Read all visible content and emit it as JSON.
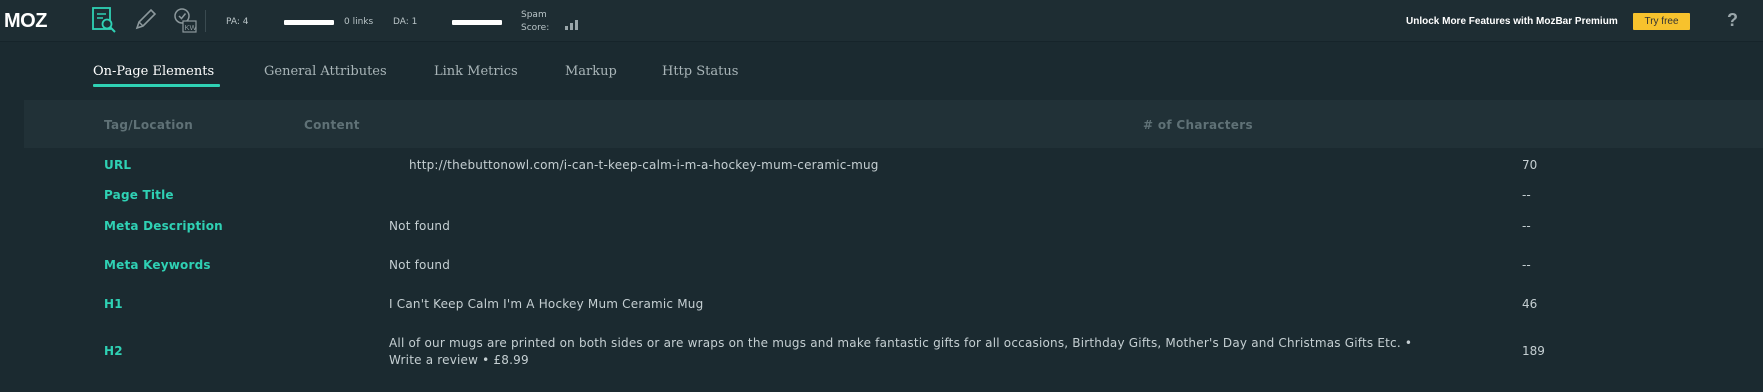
{
  "toolbar": {
    "logo": "MOZ",
    "icons": [
      "page-analysis-icon",
      "highlight-pencil-icon",
      "keyword-icon"
    ],
    "pa_label": "PA: 4",
    "pa_fill": 1.0,
    "links_label": "0 links",
    "da_label": "DA: 1",
    "da_fill": 1.0,
    "spam_label_line1": "Spam",
    "spam_label_line2": "Score:",
    "promo_text": "Unlock More Features with MozBar Premium",
    "try_button": "Try free",
    "help": "?"
  },
  "colors": {
    "accent": "#2fd1b4",
    "background": "#1b2a30",
    "try_button_bg": "#f7c22d"
  },
  "tabs": [
    {
      "label": "On-Page Elements",
      "active": true
    },
    {
      "label": "General Attributes",
      "active": false
    },
    {
      "label": "Link Metrics",
      "active": false
    },
    {
      "label": "Markup",
      "active": false
    },
    {
      "label": "Http Status",
      "active": false
    }
  ],
  "table": {
    "headers": {
      "tag": "Tag/Location",
      "content": "Content",
      "chars": "# of Characters"
    },
    "rows": [
      {
        "tag": "URL",
        "content": "http://thebuttonowl.com/i-can-t-keep-calm-i-m-a-hockey-mum-ceramic-mug",
        "chars": "70"
      },
      {
        "tag": "Page Title",
        "content": "",
        "chars": "--"
      },
      {
        "tag": "Meta Description",
        "content": "Not found",
        "chars": "--"
      },
      {
        "tag": "Meta Keywords",
        "content": "Not found",
        "chars": "--"
      },
      {
        "tag": "H1",
        "content": "I Can't Keep Calm I'm A Hockey Mum Ceramic Mug",
        "chars": "46"
      },
      {
        "tag": "H2",
        "content": "All of our mugs are printed on both sides or are wraps on the mugs and make fantastic gifts for all occasions, Birthday Gifts, Mother's Day and Christmas Gifts Etc. •",
        "content_line2": "Write a review • £8.99",
        "chars": "189"
      }
    ]
  }
}
